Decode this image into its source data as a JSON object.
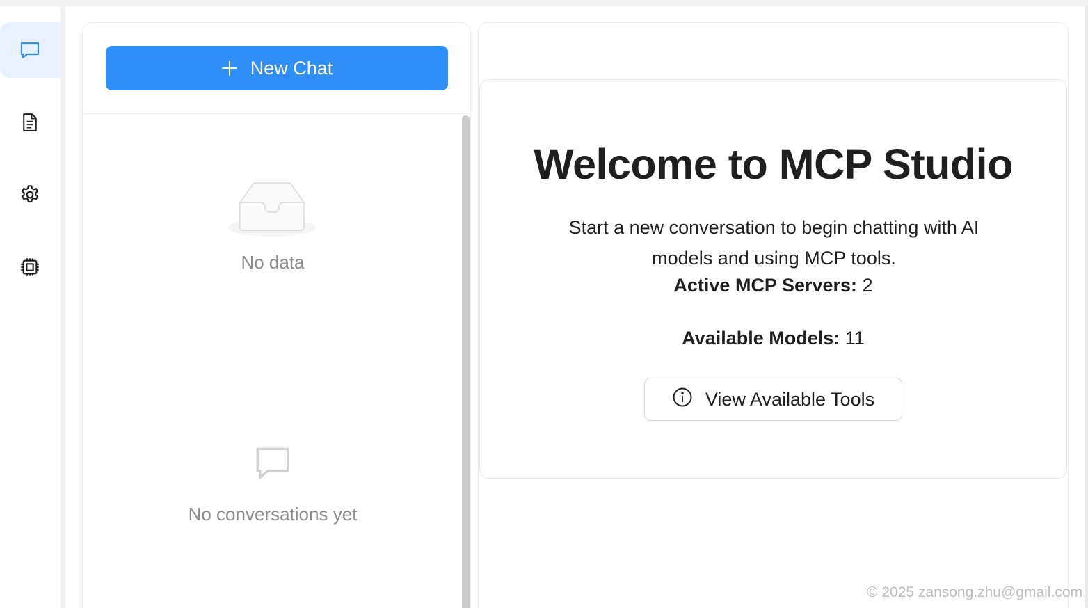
{
  "sidebar": {
    "items": [
      {
        "icon": "chat-icon",
        "active": true
      },
      {
        "icon": "document-icon",
        "active": false
      },
      {
        "icon": "gear-icon",
        "active": false
      },
      {
        "icon": "chip-icon",
        "active": false
      }
    ]
  },
  "conversations": {
    "new_chat_label": "New Chat",
    "empty_data_text": "No data",
    "empty_conversations_text": "No conversations yet"
  },
  "welcome": {
    "title": "Welcome to MCP Studio",
    "description": "Start a new conversation to begin chatting with AI models and using MCP tools.",
    "servers_label": "Active MCP Servers:",
    "servers_value": "2",
    "models_label": "Available Models:",
    "models_value": "11",
    "tools_button_label": "View Available Tools"
  },
  "footer": {
    "text": "© 2025 zansong.zhu@gmail.com"
  },
  "colors": {
    "accent": "#2f8ff8",
    "active_rail_bg": "#e8f2ff"
  }
}
